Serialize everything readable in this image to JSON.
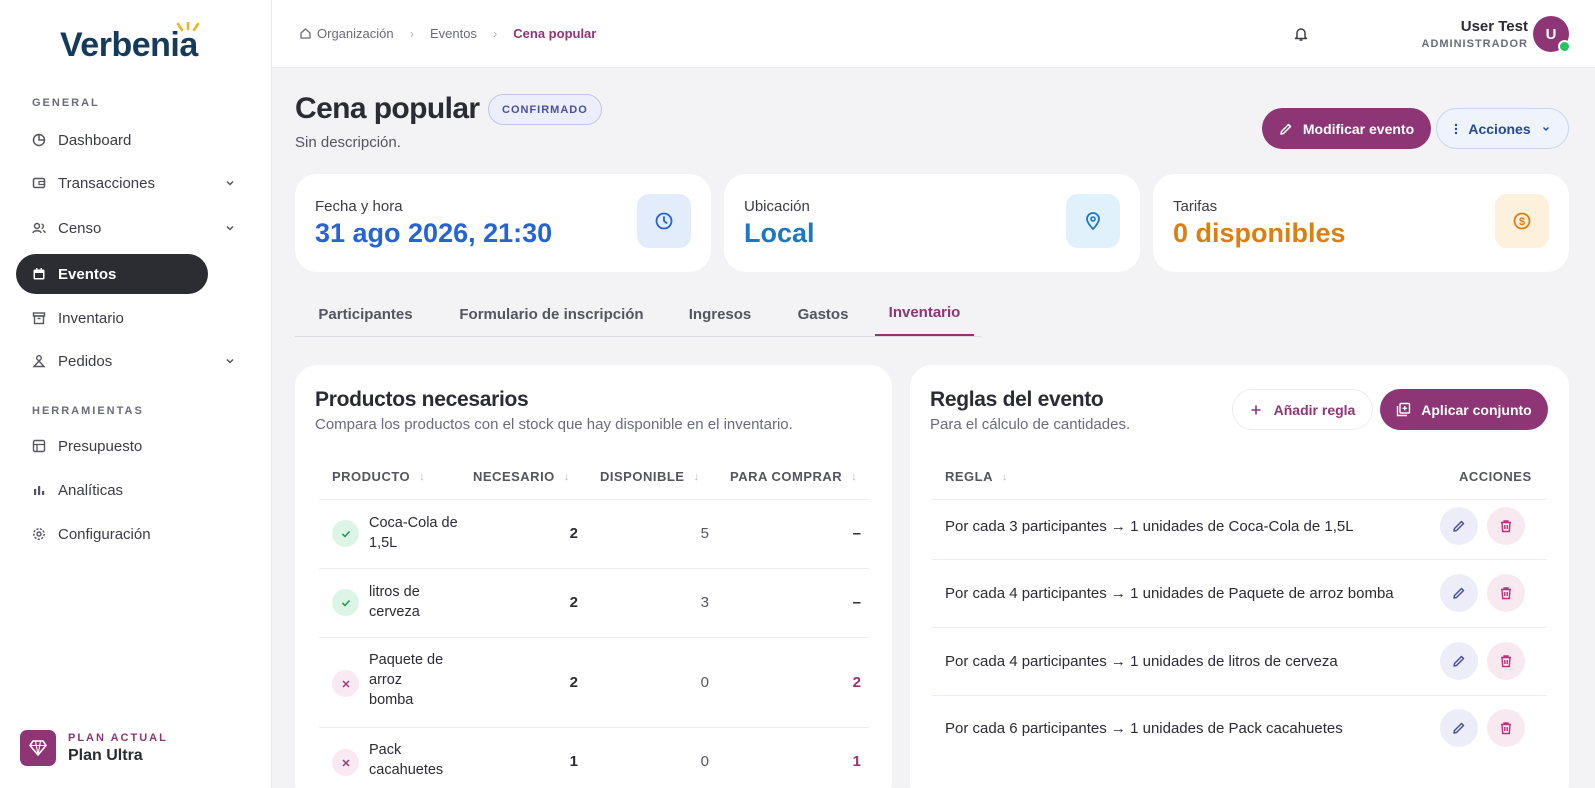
{
  "brand": {
    "name": "Verbenia"
  },
  "sidebar": {
    "sections": [
      {
        "label": "GENERAL"
      },
      {
        "label": "HERRAMIENTAS"
      }
    ],
    "items": [
      {
        "label": "Dashboard",
        "icon": "dashboard-icon"
      },
      {
        "label": "Transacciones",
        "icon": "wallet-icon",
        "expandable": true
      },
      {
        "label": "Censo",
        "icon": "users-icon",
        "expandable": true
      },
      {
        "label": "Eventos",
        "icon": "calendar-icon",
        "active": true
      },
      {
        "label": "Inventario",
        "icon": "archive-icon"
      },
      {
        "label": "Pedidos",
        "icon": "order-icon",
        "expandable": true
      },
      {
        "label": "Presupuesto",
        "icon": "budget-icon"
      },
      {
        "label": "Analíticas",
        "icon": "bar-chart-icon"
      },
      {
        "label": "Configuración",
        "icon": "settings-icon"
      }
    ],
    "plan": {
      "label": "PLAN ACTUAL",
      "name": "Plan Ultra"
    }
  },
  "topbar": {
    "breadcrumb": [
      "Organización",
      "Eventos",
      "Cena popular"
    ],
    "user": {
      "name": "User Test",
      "role": "ADMINISTRADOR",
      "initial": "U"
    }
  },
  "event": {
    "title": "Cena popular",
    "status": "CONFIRMADO",
    "description": "Sin descripción.",
    "edit_label": "Modificar evento",
    "actions_label": "Acciones"
  },
  "stats": [
    {
      "label": "Fecha y hora",
      "value": "31 ago 2026, 21:30",
      "color": "#2563d6",
      "icon": "clock-icon"
    },
    {
      "label": "Ubicación",
      "value": "Local",
      "color": "#1d77c2",
      "icon": "location-pin-icon"
    },
    {
      "label": "Tarifas",
      "value": "0 disponibles",
      "color": "#dc7f11",
      "icon": "dollar-coin-icon"
    }
  ],
  "tabs": [
    {
      "label": "Participantes"
    },
    {
      "label": "Formulario de inscripción"
    },
    {
      "label": "Ingresos"
    },
    {
      "label": "Gastos"
    },
    {
      "label": "Inventario",
      "active": true
    }
  ],
  "products": {
    "title": "Productos necesarios",
    "subtitle": "Compara los productos con el stock que hay disponible en el inventario.",
    "columns": [
      "PRODUCTO",
      "NECESARIO",
      "DISPONIBLE",
      "PARA COMPRAR"
    ],
    "rows": [
      {
        "name": "Coca-Cola de 1,5L",
        "ok": true,
        "needed": "2",
        "available": "5",
        "to_buy": "–"
      },
      {
        "name": "litros de cerveza",
        "ok": true,
        "needed": "2",
        "available": "3",
        "to_buy": "–"
      },
      {
        "name": "Paquete de arroz bomba",
        "ok": false,
        "needed": "2",
        "available": "0",
        "to_buy": "2"
      },
      {
        "name": "Pack cacahuetes",
        "ok": false,
        "needed": "1",
        "available": "0",
        "to_buy": "1"
      }
    ]
  },
  "rules": {
    "title": "Reglas del evento",
    "subtitle": "Para el cálculo de cantidades.",
    "add_label": "Añadir regla",
    "apply_label": "Aplicar conjunto",
    "columns": [
      "REGLA",
      "ACCIONES"
    ],
    "rows": [
      {
        "text": "Por cada 3 participantes → 1 unidades de Coca-Cola de 1,5L"
      },
      {
        "text": "Por cada 4 participantes → 1 unidades de Paquete de arroz bomba"
      },
      {
        "text": "Por cada 4 participantes → 1 unidades de litros de cerveza"
      },
      {
        "text": "Por cada 6 participantes → 1 unidades de Pack cacahuetes"
      }
    ]
  },
  "colors": {
    "accent": "#8d3575",
    "sidebar_active": "#2c2c33",
    "ok": "#1f9d55"
  }
}
